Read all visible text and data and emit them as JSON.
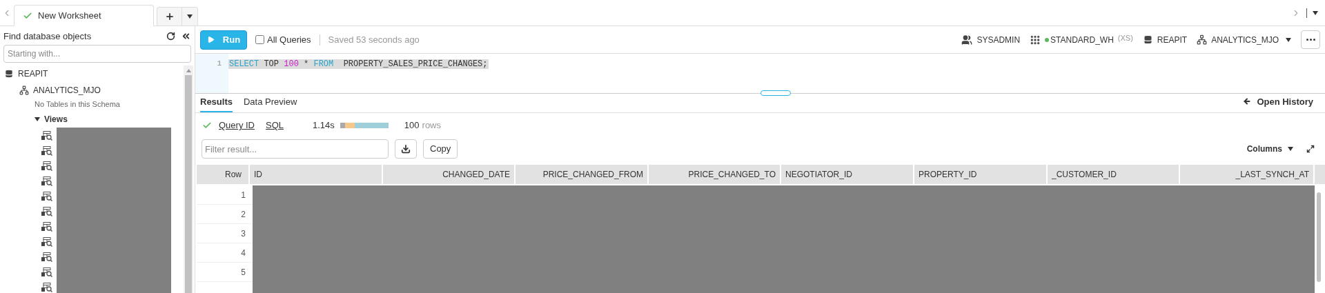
{
  "worksheet_tabs": [
    {
      "label": "New Worksheet",
      "selected": true,
      "succeeded": true
    }
  ],
  "sidebar": {
    "title": "Find database objects",
    "search": {
      "placeholder": "Starting with..."
    },
    "tree": [
      {
        "label": "REAPIT",
        "kind": "database",
        "children": [
          {
            "label": "ANALYTICS_MJO",
            "kind": "schema",
            "note": "No Tables in this Schema",
            "children": [
              {
                "label": "Views",
                "kind": "folder",
                "expanded": true
              }
            ]
          }
        ]
      }
    ]
  },
  "toolbar": {
    "run": "Run",
    "all_queries": {
      "label": "All Queries",
      "checked": false
    },
    "saved": "Saved 53 seconds ago",
    "context": [
      {
        "kind": "role",
        "label": "SYSADMIN"
      },
      {
        "kind": "warehouse",
        "label": "STANDARD_WH",
        "size": "(XS)",
        "color": "#5cb85c"
      },
      {
        "kind": "database",
        "label": "REAPIT"
      },
      {
        "kind": "schema",
        "label": "ANALYTICS_MJO"
      }
    ]
  },
  "editor": {
    "lines": [
      {
        "number": "1",
        "selected": true,
        "tokens": [
          {
            "text": "SELECT",
            "kind": "keyword"
          },
          {
            "text": " TOP ",
            "kind": "plain"
          },
          {
            "text": "100",
            "kind": "number"
          },
          {
            "text": " * ",
            "kind": "plain"
          },
          {
            "text": "FROM",
            "kind": "keyword"
          },
          {
            "text": "  PROPERTY_SALES_PRICE_CHANGES;",
            "kind": "plain"
          }
        ]
      }
    ]
  },
  "result_tabs": [
    {
      "label": "Results",
      "selected": true
    },
    {
      "label": "Data Preview",
      "selected": false
    }
  ],
  "open_history": "Open History",
  "query_info": {
    "succeeded": true,
    "query_id": "Query ID",
    "sql": "SQL",
    "duration": "1.14s",
    "row_count": "100",
    "row_unit": "rows"
  },
  "filter": {
    "placeholder": "Filter result..."
  },
  "copy": "Copy",
  "columns_menu": "Columns",
  "table": {
    "row_header": "Row",
    "columns": [
      {
        "label": "ID",
        "kind": "text"
      },
      {
        "label": "CHANGED_DATE",
        "kind": "numeric"
      },
      {
        "label": "PRICE_CHANGED_FROM",
        "kind": "numeric"
      },
      {
        "label": "PRICE_CHANGED_TO",
        "kind": "numeric"
      },
      {
        "label": "NEGOTIATOR_ID",
        "kind": "text"
      },
      {
        "label": "PROPERTY_ID",
        "kind": "text"
      },
      {
        "label": "_CUSTOMER_ID",
        "kind": "text"
      },
      {
        "label": "_LAST_SYNCH_AT",
        "kind": "numeric"
      }
    ],
    "rows": [
      "1",
      "2",
      "3",
      "4",
      "5"
    ]
  }
}
